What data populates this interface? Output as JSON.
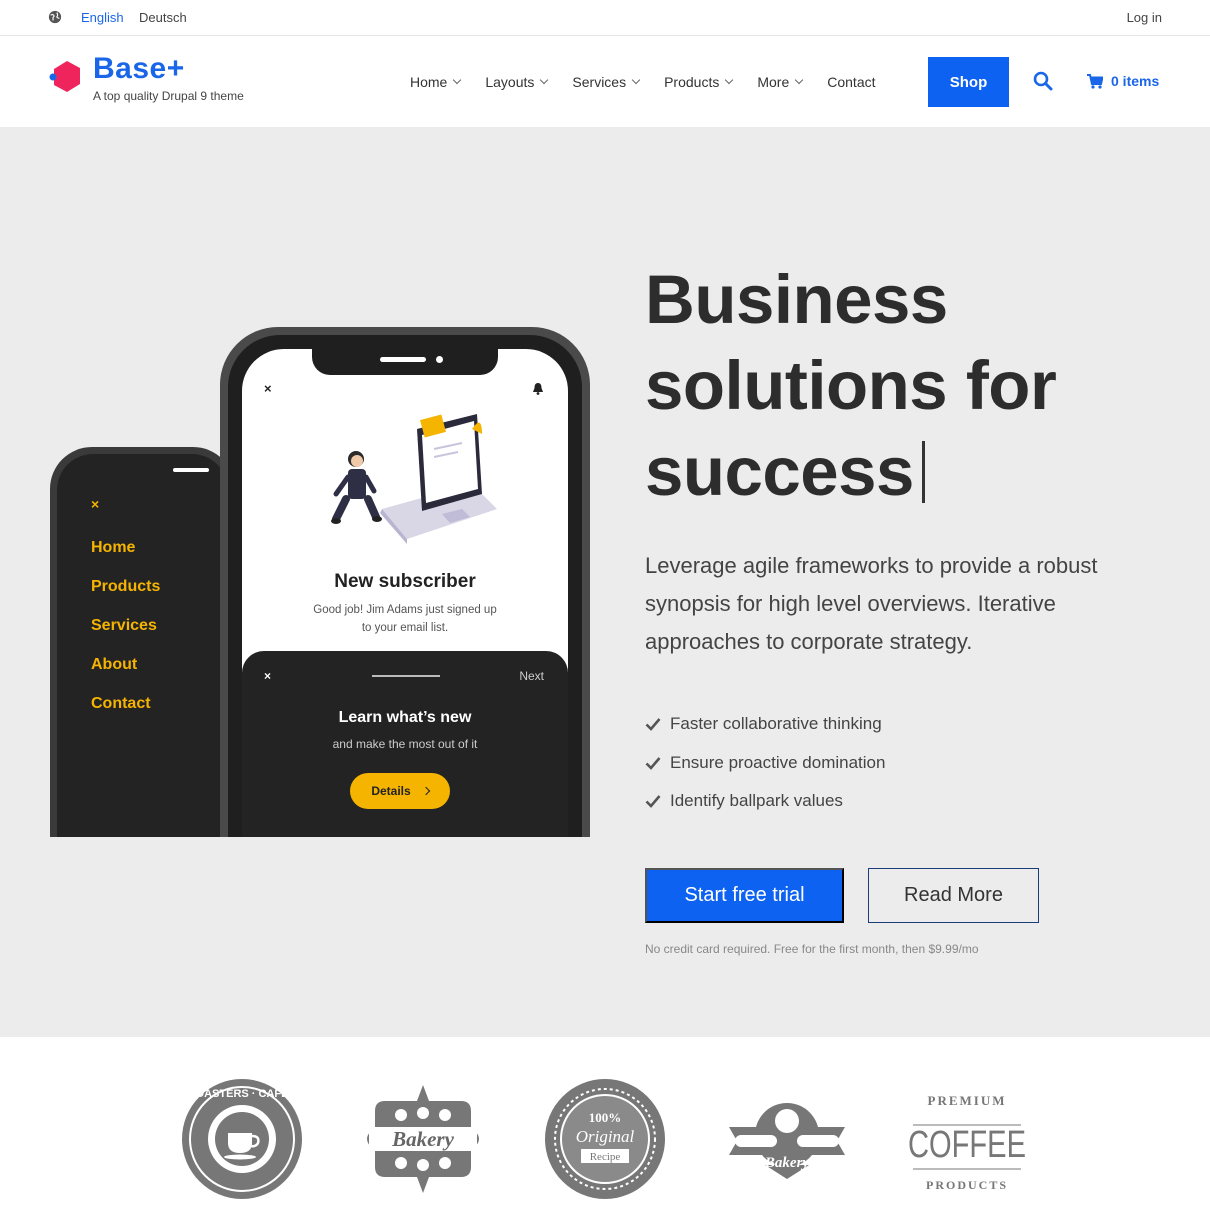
{
  "topbar": {
    "languages": [
      "English",
      "Deutsch"
    ],
    "active_language": "English",
    "login": "Log in"
  },
  "header": {
    "brand": "Base+",
    "tagline": "A top quality Drupal 9 theme",
    "nav": [
      "Home",
      "Layouts",
      "Services",
      "Products",
      "More",
      "Contact"
    ],
    "nav_dropdown": [
      true,
      true,
      true,
      true,
      true,
      false
    ],
    "shop": "Shop",
    "cart": "0 items"
  },
  "hero": {
    "headline_lines": [
      "Business",
      "solutions for",
      "success"
    ],
    "lede": "Leverage agile frameworks to provide a robust synopsis for high level overviews. Iterative approaches to corporate strategy.",
    "checks": [
      "Faster collaborative thinking",
      "Ensure proactive domination",
      "Identify ballpark values"
    ],
    "cta_primary": "Start free trial",
    "cta_secondary": "Read More",
    "fine_print": "No credit card required. Free for the first month, then $9.99/mo"
  },
  "mockup": {
    "back_menu": [
      "Home",
      "Products",
      "Services",
      "About",
      "Contact"
    ],
    "close_glyph": "×",
    "notification_title": "New subscriber",
    "notification_text": "Good job! Jim Adams just signed up to your email list.",
    "panel_next": "Next",
    "panel_title": "Learn what’s new",
    "panel_text": "and make the most out of it",
    "details": "Details"
  },
  "logos": [
    {
      "icon": "coffee-roasters-badge",
      "text": "COFFEE ROASTERS · CAFE & BISTRO"
    },
    {
      "icon": "bakery-badge",
      "text": "Bakery"
    },
    {
      "icon": "original-recipe-badge",
      "text": "100% Original Recipe"
    },
    {
      "icon": "bakery-ribbon-badge",
      "text": "Bakery"
    },
    {
      "icon": "premium-coffee-badge",
      "text": "PREMIUM COFFEE PRODUCTS"
    }
  ],
  "colors": {
    "accent": "#0d62f2",
    "brand_text": "#1a66e8",
    "logo_mark": "#f0245d",
    "hero_bg": "#ececec",
    "mockup_yellow": "#f5b400"
  }
}
